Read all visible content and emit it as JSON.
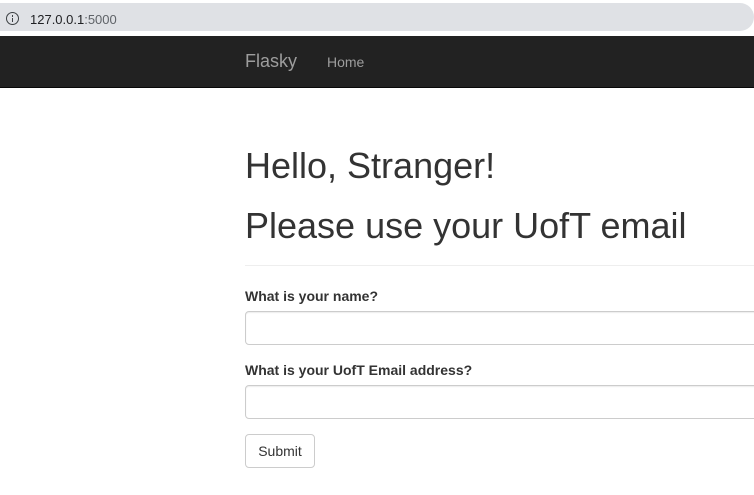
{
  "browser": {
    "url_host": "127.0.0.1",
    "url_port": ":5000",
    "info_icon": "info-circle-icon"
  },
  "navbar": {
    "brand": "Flasky",
    "links": [
      {
        "label": "Home"
      }
    ],
    "background": "#222222",
    "link_color": "#9d9d9d"
  },
  "page": {
    "greeting": "Hello, Stranger!",
    "notice": "Please use your UofT email"
  },
  "form": {
    "name_label": "What is your name?",
    "name_value": "",
    "email_label": "What is your UofT Email address?",
    "email_value": "",
    "submit_label": "Submit"
  }
}
